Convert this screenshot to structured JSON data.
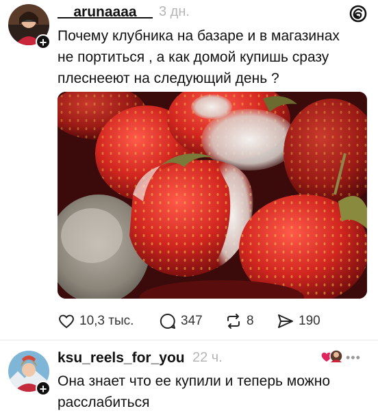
{
  "post": {
    "username": "__arunaaaa__",
    "time": "3 дн.",
    "text_lines": [
      "Почему клубника на базаре и в магазинах",
      "не портиться , а как домой купишь сразу",
      "плеснееют на следующий день ?"
    ],
    "image_icon": "moldy-strawberries-photo",
    "actions": {
      "likes": "10,3 тыс.",
      "comments": "347",
      "reposts": "8",
      "shares": "190"
    }
  },
  "reply": {
    "username": "ksu_reels_for_you",
    "time": "22 ч.",
    "text_lines": [
      "Она знает что ее купили и теперь можно",
      "расслабиться"
    ],
    "more_label": "•••"
  },
  "icons": {
    "logo": "threads-logo-icon",
    "like": "heart-icon",
    "comment": "comment-bubble-icon",
    "repost": "repost-arrows-icon",
    "share": "send-icon",
    "follow": "plus-icon"
  },
  "colors": {
    "text": "#111111",
    "muted": "#b5b5b5",
    "heart_red": "#e0245e"
  }
}
